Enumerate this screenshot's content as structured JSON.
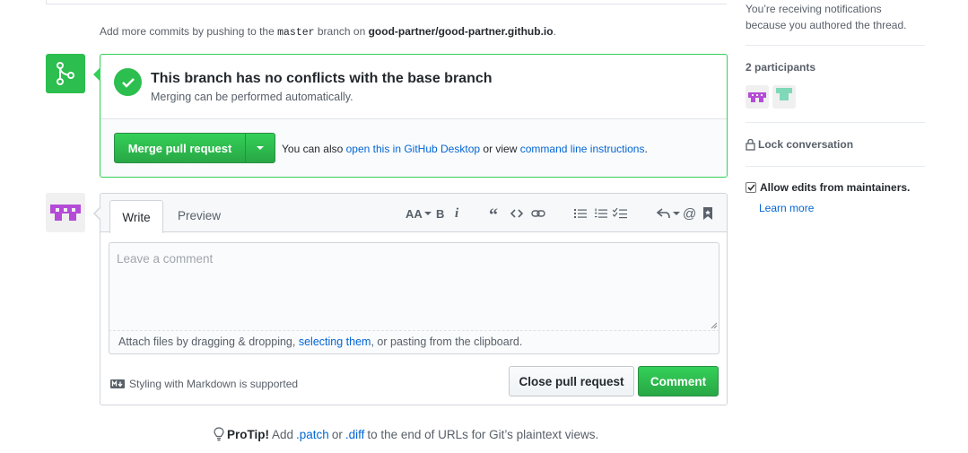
{
  "push_note": {
    "prefix": "Add more commits by pushing to the",
    "branch": "master",
    "middle": "branch on",
    "repo": "good-partner/good-partner.github.io",
    "suffix": "."
  },
  "merge": {
    "title": "This branch has no conflicts with the base branch",
    "subtitle": "Merging can be performed automatically.",
    "button_label": "Merge pull request",
    "alt_prefix": "You can also",
    "alt_link1": "open this in GitHub Desktop",
    "alt_middle": "or view",
    "alt_link2": "command line instructions",
    "alt_suffix": "."
  },
  "comment": {
    "tab_write": "Write",
    "tab_preview": "Preview",
    "placeholder": "Leave a comment",
    "attach_prefix": "Attach files by dragging & dropping,",
    "attach_link": "selecting them",
    "attach_suffix": ", or pasting from the clipboard.",
    "markdown_note": "Styling with Markdown is supported",
    "close_button": "Close pull request",
    "comment_button": "Comment",
    "toolbar": {
      "header": "AA",
      "bold": "B",
      "italic": "i",
      "quote": "“",
      "mention": "@"
    }
  },
  "protip": {
    "label": "ProTip!",
    "text1": "Add",
    "link1": ".patch",
    "text2": "or",
    "link2": ".diff",
    "text3": "to the end of URLs for Git’s plaintext views."
  },
  "sidebar": {
    "notification_text": "You’re receiving notifications because you authored the thread.",
    "participants_title": "2 participants",
    "lock_label": "Lock conversation",
    "allow_edits_label": "Allow edits from maintainers.",
    "allow_edits_checked": true,
    "learn_more": "Learn more"
  },
  "colors": {
    "green": "#2cbe4e",
    "link": "#0366d6",
    "avatar_purple": "#b44cd8",
    "avatar_teal": "#7fd8b8"
  },
  "icons": [
    "git-merge-icon",
    "check-icon",
    "lock-icon",
    "lightbulb-icon",
    "markdown-icon"
  ]
}
